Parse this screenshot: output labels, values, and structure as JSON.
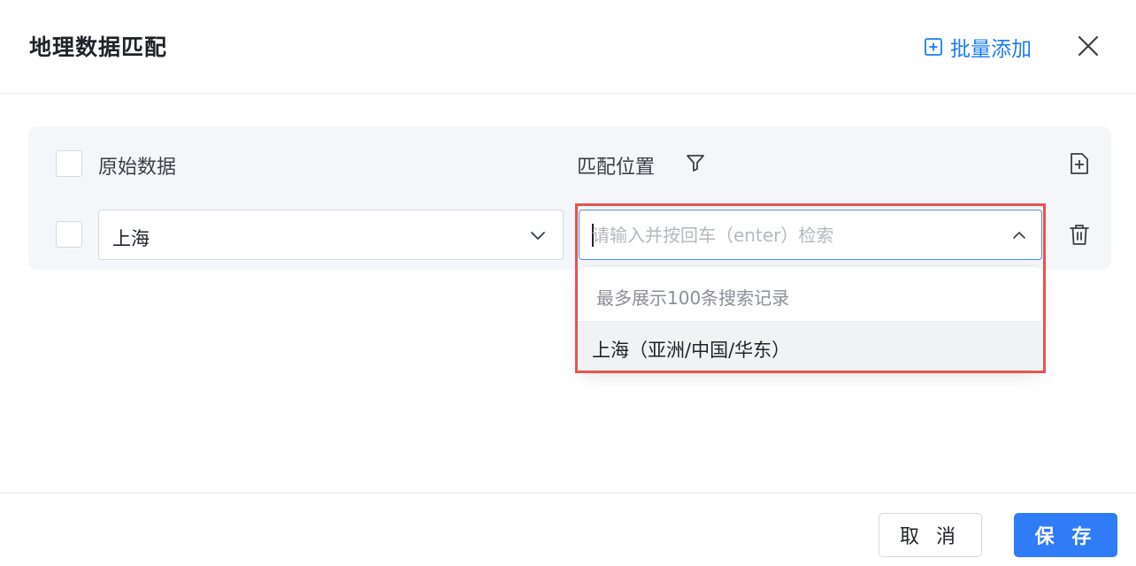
{
  "dialog": {
    "title": "地理数据匹配",
    "batch_add_label": "批量添加"
  },
  "table": {
    "col_raw_label": "原始数据",
    "col_match_label": "匹配位置",
    "rows": [
      {
        "raw_value": "上海",
        "match_placeholder": "请输入并按回车（enter）检索"
      }
    ]
  },
  "dropdown": {
    "hint": "最多展示100条搜索记录",
    "options": [
      "上海（亚洲/中国/华东）"
    ]
  },
  "footer": {
    "cancel_label": "取 消",
    "save_label": "保 存"
  },
  "colors": {
    "accent": "#1b7bf4",
    "primary_button": "#2f7cf6",
    "highlight_border": "#e8534f",
    "panel_bg": "#f5f6fa"
  },
  "icons": {
    "batch_add": "add-square-icon",
    "close": "close-icon",
    "filter": "filter-icon",
    "add_row": "add-row-icon",
    "delete": "trash-icon",
    "chevron_down": "chevron-down-icon",
    "chevron_up": "chevron-up-icon"
  }
}
